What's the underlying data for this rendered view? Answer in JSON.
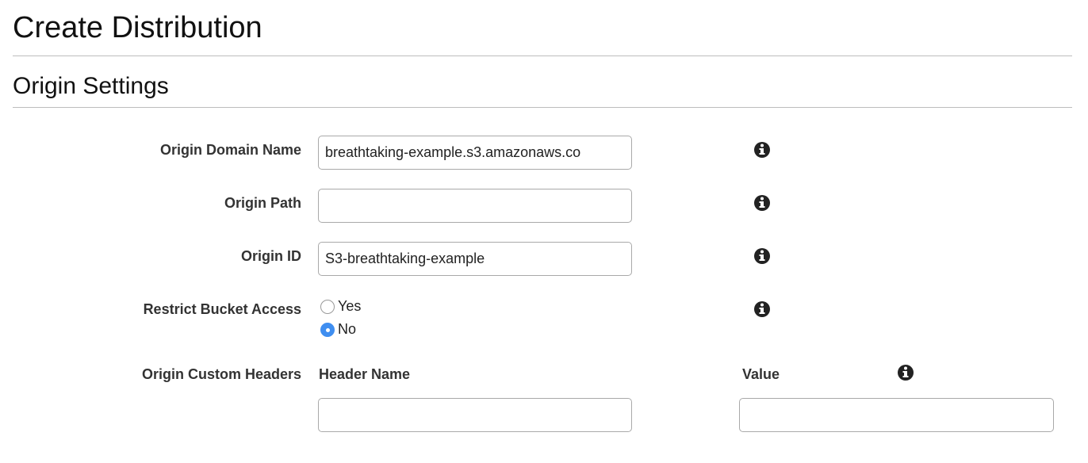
{
  "page": {
    "title": "Create Distribution",
    "section_title": "Origin Settings"
  },
  "fields": {
    "origin_domain_name": {
      "label": "Origin Domain Name",
      "value": "breathtaking-example.s3.amazonaws.co"
    },
    "origin_path": {
      "label": "Origin Path",
      "value": ""
    },
    "origin_id": {
      "label": "Origin ID",
      "value": "S3-breathtaking-example"
    },
    "restrict_bucket_access": {
      "label": "Restrict Bucket Access",
      "options": [
        {
          "label": "Yes",
          "selected": false
        },
        {
          "label": "No",
          "selected": true
        }
      ]
    },
    "origin_custom_headers": {
      "label": "Origin Custom Headers",
      "header_name_label": "Header Name",
      "value_label": "Value",
      "header_name_value": "",
      "value_value": ""
    }
  },
  "icons": {
    "info": "info-icon"
  },
  "colors": {
    "radio_checked": "#3f8ef0",
    "rule": "#bdbdbd",
    "input_border": "#a9a9a9"
  }
}
